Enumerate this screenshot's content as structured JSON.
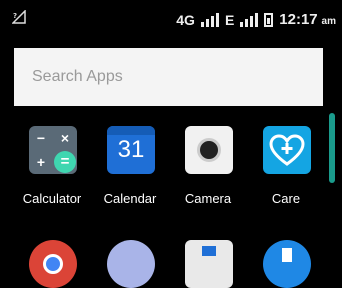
{
  "status_bar": {
    "network_type": "4G",
    "network_e": "E",
    "time": "12:17",
    "ampm": "am"
  },
  "search": {
    "placeholder": "Search Apps"
  },
  "apps": [
    {
      "label": "Calculator",
      "icon": "calculator-icon"
    },
    {
      "label": "Calendar",
      "icon": "calendar-icon",
      "day": "31"
    },
    {
      "label": "Camera",
      "icon": "camera-icon"
    },
    {
      "label": "Care",
      "icon": "care-icon"
    }
  ],
  "colors": {
    "accent_teal": "#1a9b8c",
    "calendar_blue": "#1f6fd6",
    "care_blue": "#14a5e3"
  }
}
